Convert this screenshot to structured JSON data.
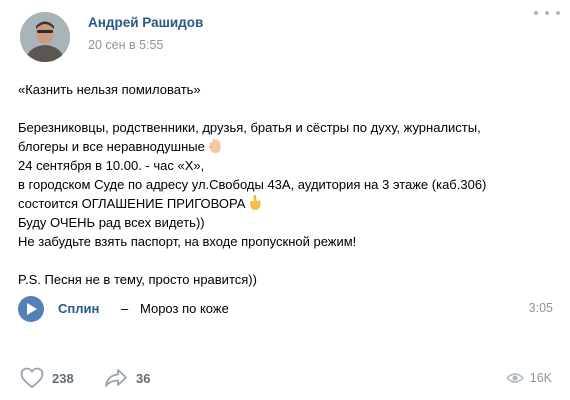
{
  "post": {
    "author": "Андрей Рашидов",
    "date": "20 сен в 5:55",
    "lines": [
      "«Казнить нельзя помиловать»",
      "",
      "Березниковцы, родственники, друзья, братья и сёстры по духу, журналисты,",
      "блогеры и все неравнодушные",
      "24 сентября в 10.00. - час «Х»,",
      "в городском Суде по адресу ул.Свободы 43А, аудитория на 3 этаже (каб.306)",
      "состоится ОГЛАШЕНИЕ ПРИГОВОРА",
      "Буду ОЧЕНЬ рад всех видеть))",
      "Не забудьте взять паспорт, на входе пропускной режим!",
      "",
      "P.S. Песня не в тему, просто нравится))"
    ]
  },
  "audio": {
    "artist": "Сплин",
    "separator": "–",
    "title": "Мороз по коже",
    "duration": "3:05"
  },
  "footer": {
    "likes": "238",
    "shares": "36",
    "views": "16K"
  },
  "icons": {
    "more": "more-dots-icon",
    "hand_wave": "raised-hand-emoji",
    "pointing": "pointing-down-emoji",
    "play": "play-icon",
    "like": "heart-icon",
    "share": "share-arrow-icon",
    "views": "eye-icon"
  },
  "colors": {
    "link": "#2a5885",
    "secondary": "#939393",
    "accent": "#5181b8",
    "action": "#626d7a"
  }
}
